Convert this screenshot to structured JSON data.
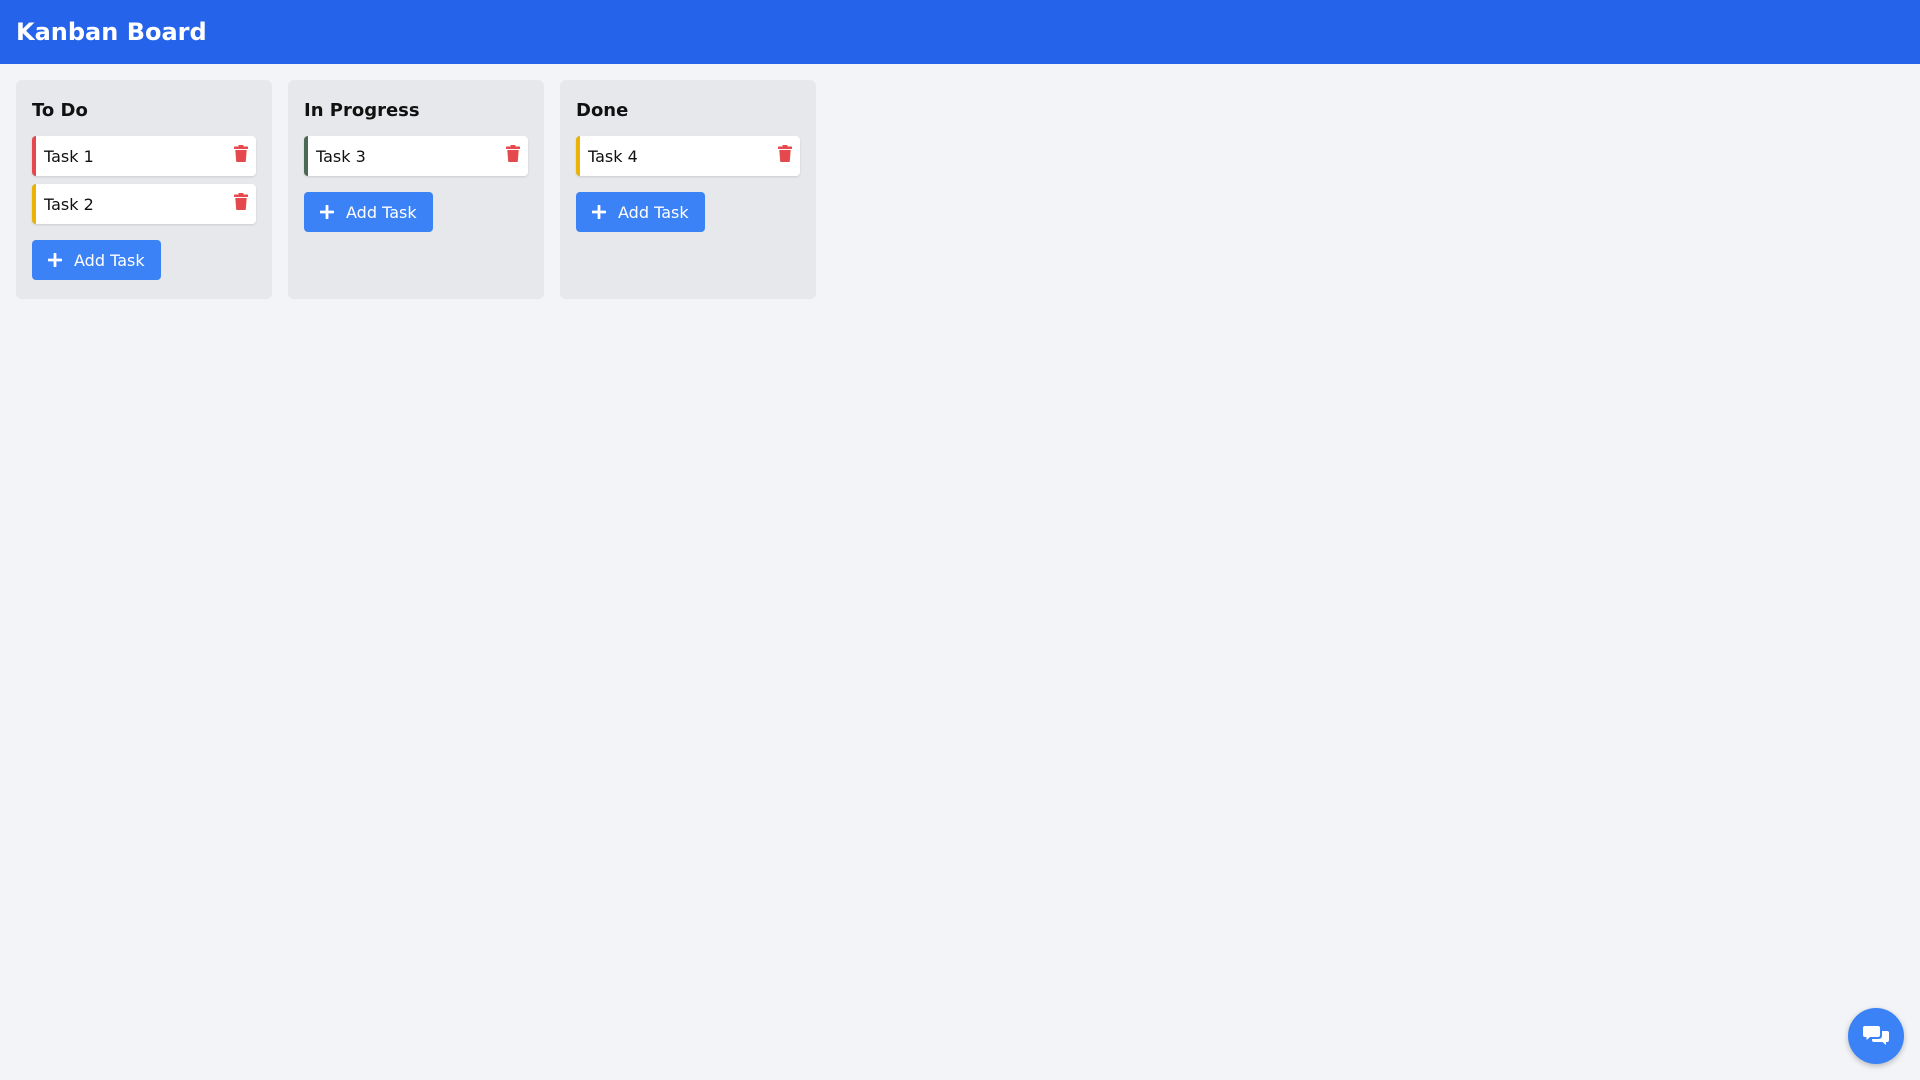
{
  "header": {
    "title": "Kanban Board",
    "color": "#2563eb"
  },
  "columns": [
    {
      "title": "To Do",
      "add_label": "Add Task",
      "tasks": [
        {
          "label": "Task 1",
          "color": "#e5484d"
        },
        {
          "label": "Task 2",
          "color": "#eab308"
        }
      ]
    },
    {
      "title": "In Progress",
      "add_label": "Add Task",
      "tasks": [
        {
          "label": "Task 3",
          "color": "#4a6a55"
        }
      ]
    },
    {
      "title": "Done",
      "add_label": "Add Task",
      "tasks": [
        {
          "label": "Task 4",
          "color": "#eab308"
        }
      ]
    }
  ],
  "icons": {
    "delete": "trash-icon",
    "add": "plus-icon",
    "chat": "chat-icon"
  },
  "colors": {
    "accent": "#3b82f6",
    "delete": "#e5484d",
    "background": "#f2f4f7",
    "column": "#e6e8eb"
  }
}
